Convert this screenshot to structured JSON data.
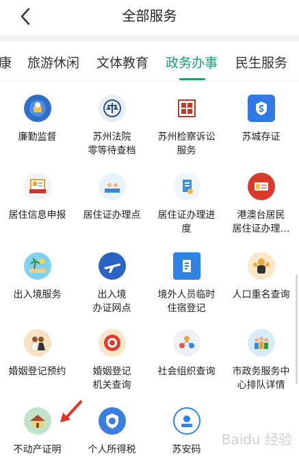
{
  "header": {
    "title": "全部服务"
  },
  "tabs": [
    {
      "label": "康"
    },
    {
      "label": "旅游休闲"
    },
    {
      "label": "文体教育"
    },
    {
      "label": "政务办事",
      "active": true
    },
    {
      "label": "民生服务"
    }
  ],
  "services": [
    {
      "label": "廉勤监督",
      "icon": "shield-clock-icon"
    },
    {
      "label": "苏州法院\n零等待查档",
      "icon": "court-scale-icon"
    },
    {
      "label": "苏州检察诉讼\n服务",
      "icon": "procuratorate-seal-icon"
    },
    {
      "label": "苏城存证",
      "icon": "certificate-s-icon"
    },
    {
      "label": "居住信息申报",
      "icon": "residence-form-icon"
    },
    {
      "label": "居住证办理点",
      "icon": "service-desk-icon"
    },
    {
      "label": "居住证办理进\n度",
      "icon": "progress-document-icon"
    },
    {
      "label": "港澳台居民\n居住证办理…",
      "icon": "residence-card-icon"
    },
    {
      "label": "出入境服务",
      "icon": "travel-island-icon"
    },
    {
      "label": "出入境\n办证网点",
      "icon": "airplane-icon"
    },
    {
      "label": "境外人员临时\n住宿登记",
      "icon": "registration-book-icon"
    },
    {
      "label": "人口重名查询",
      "icon": "people-search-icon"
    },
    {
      "label": "婚姻登记预约",
      "icon": "couple-icon"
    },
    {
      "label": "婚姻登记\n机关查询",
      "icon": "double-happiness-icon"
    },
    {
      "label": "社会组织查询",
      "icon": "organization-icon"
    },
    {
      "label": "市政务服务中\n心排队详情",
      "icon": "queue-crowd-icon"
    },
    {
      "label": "不动产证明",
      "icon": "house-icon"
    },
    {
      "label": "个人所得税",
      "icon": "tax-shield-icon"
    },
    {
      "label": "苏安码",
      "icon": "su-an-code-icon"
    }
  ],
  "watermark": "Baidu 经验"
}
